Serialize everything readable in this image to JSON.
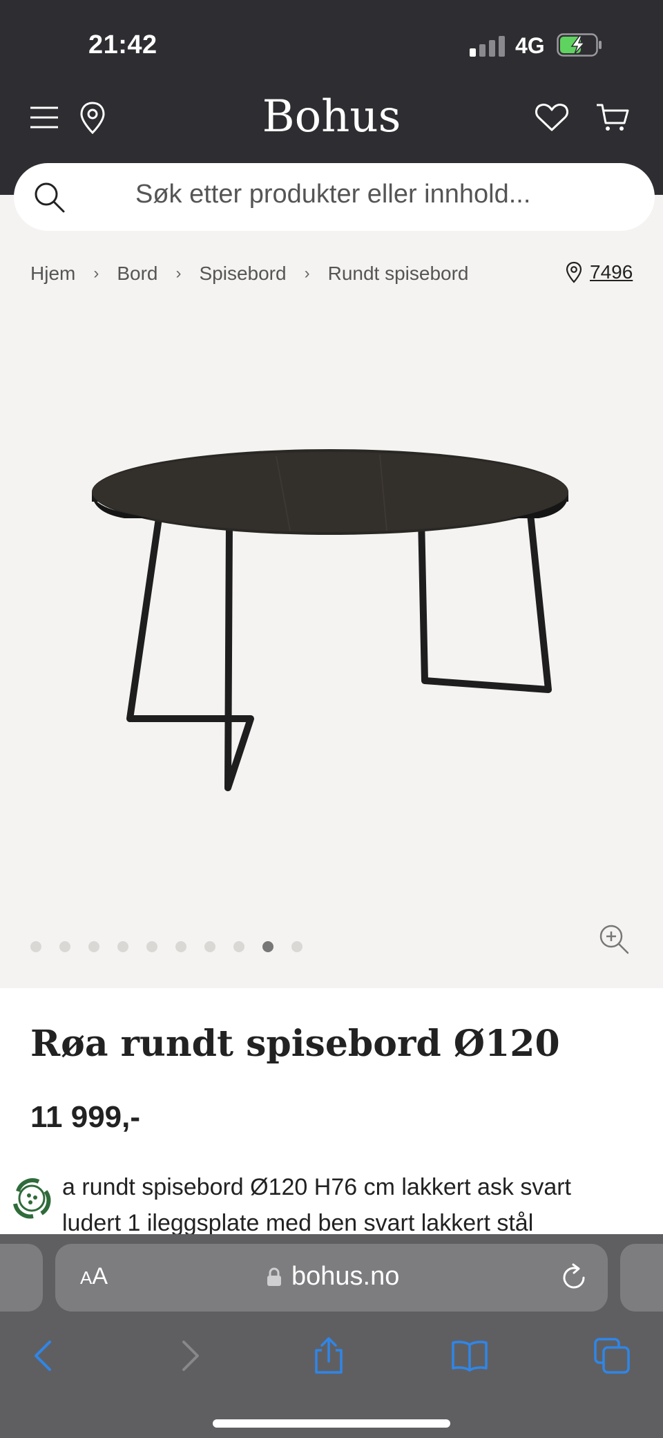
{
  "status_bar": {
    "time": "21:42",
    "network": "4G"
  },
  "header": {
    "logo": "Bohus"
  },
  "search": {
    "placeholder": "Søk etter produkter eller innhold..."
  },
  "breadcrumb": [
    "Hjem",
    "Bord",
    "Spisebord",
    "Rundt spisebord"
  ],
  "store": {
    "number": "7496"
  },
  "gallery": {
    "total": 10,
    "active_index": 8
  },
  "product": {
    "title": "Røa rundt spisebord Ø120",
    "price": "11 999,-",
    "description_line1": "a rundt spisebord Ø120 H76 cm lakkert ask svart",
    "description_line2": "ludert 1 ileggsplate med ben svart lakkert stål"
  },
  "browser": {
    "aa_label": "AA",
    "url": "bohus.no"
  },
  "colors": {
    "header_bg": "#2e2e32",
    "page_bg": "#f4f3f1",
    "safari_blue": "#2f86e8",
    "eco_green": "#2f6b3a"
  }
}
